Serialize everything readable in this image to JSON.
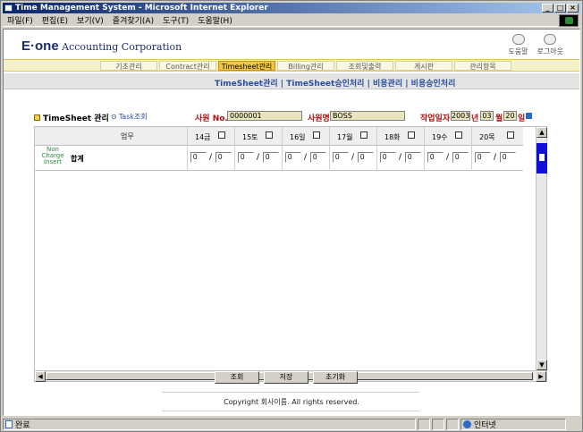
{
  "window": {
    "title": "Time Management System - Microsoft Internet Explorer",
    "controls": [
      "_",
      "□",
      "×"
    ]
  },
  "menu": [
    "파일(F)",
    "편집(E)",
    "보기(V)",
    "즐겨찾기(A)",
    "도구(T)",
    "도움말(H)"
  ],
  "brand": {
    "mark": "E·one",
    "name": "Accounting Corporation"
  },
  "toplinks": [
    {
      "label": "도움말",
      "icon": "help-icon"
    },
    {
      "label": "로그아웃",
      "icon": "logout-icon"
    }
  ],
  "tabs": [
    "기초관리",
    "Contract관리",
    "Timesheet관리",
    "Billing관리",
    "조회및출력",
    "게시판",
    "관리항목"
  ],
  "active_tab": "Timesheet관리",
  "subnav": "TimeSheet관리 | TimeSheet승인처리 | 비용관리 | 비용승인처리",
  "section": {
    "title": "TimeSheet 관리",
    "task_link": "Task조회",
    "employee_no_label": "사원 No.",
    "employee_no": "0000001",
    "employee_name_label": "사원명",
    "employee_name": "BOSS",
    "date_label": "작업일자",
    "year": "2003",
    "year_unit": "년",
    "month": "03",
    "month_unit": "월",
    "day": "20",
    "day_unit": "일"
  },
  "grid": {
    "task_header": "업무",
    "days": [
      "14금",
      "15토",
      "16일",
      "17월",
      "18화",
      "19수",
      "20목"
    ],
    "row_label": "Non Charge Insert",
    "row_name": "합계",
    "cells": [
      [
        "0",
        "0"
      ],
      [
        "0",
        "0"
      ],
      [
        "0",
        "0"
      ],
      [
        "0",
        "0"
      ],
      [
        "0",
        "0"
      ],
      [
        "0",
        "0"
      ],
      [
        "0",
        "0"
      ]
    ]
  },
  "buttons": {
    "query": "조회",
    "save": "저장",
    "reset": "초기화"
  },
  "copyright": "Copyright 회사이름. All rights reserved.",
  "status": {
    "main": "완료",
    "zone": "인터넷"
  }
}
